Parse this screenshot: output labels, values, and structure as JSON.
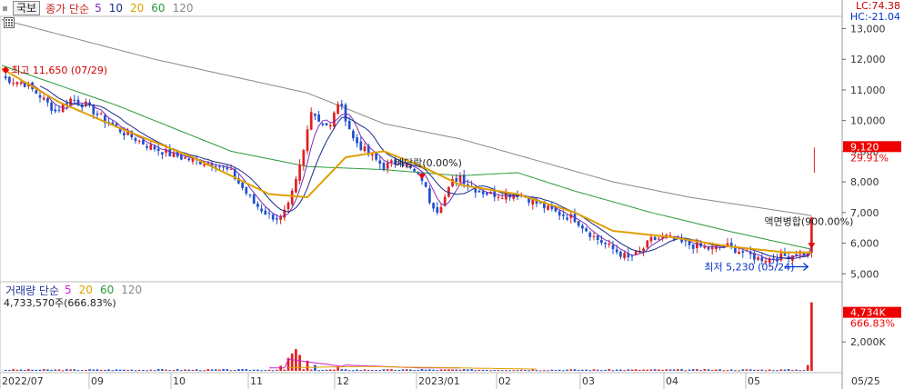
{
  "header": {
    "stock_button": "국보",
    "price_label": "종가 단순",
    "ma_periods": [
      "5",
      "10",
      "20",
      "60",
      "120"
    ],
    "ma_colors": [
      "#7a2fb8",
      "#1a2a8a",
      "#e0a000",
      "#2a9a3a",
      "#888888"
    ]
  },
  "volume_header": {
    "label": "거래량 단순",
    "ma_periods": [
      "5",
      "20",
      "60",
      "120"
    ],
    "value_text": "4,733,570주(666.83%)"
  },
  "readout": {
    "lc": "LC:74.38",
    "hc": "HC:-21.04"
  },
  "price_axis": {
    "ticks": [
      "13,000",
      "12,000",
      "11,000",
      "10,000",
      "9,000",
      "8,000",
      "7,000",
      "6,000",
      "5,000"
    ],
    "current_price": "9,120",
    "current_change": "29.91%"
  },
  "volume_axis": {
    "ticks": [
      "2,000K"
    ],
    "current_volume": "4,734K",
    "current_change": "666.83%"
  },
  "annotations": {
    "high": "최고 11,650 (07/29)",
    "low": "최저 5,230 (05/24)",
    "event1": "배당락(0.00%)",
    "event2": "액면병합(900.00%)"
  },
  "x_axis": {
    "labels": [
      "2022/07",
      "09",
      "10",
      "11",
      "12",
      "2023/01",
      "02",
      "03",
      "04",
      "05",
      "05/25"
    ]
  },
  "chart_data": {
    "type": "line",
    "y_range": [
      4800,
      13400
    ],
    "x_range": [
      0,
      220
    ],
    "close_series_anchors": [
      [
        0,
        11400
      ],
      [
        6,
        11200
      ],
      [
        10,
        10800
      ],
      [
        14,
        10300
      ],
      [
        18,
        10700
      ],
      [
        22,
        10500
      ],
      [
        27,
        10000
      ],
      [
        32,
        9600
      ],
      [
        38,
        9200
      ],
      [
        44,
        8900
      ],
      [
        50,
        8700
      ],
      [
        56,
        8600
      ],
      [
        60,
        8300
      ],
      [
        63,
        7800
      ],
      [
        66,
        7300
      ],
      [
        70,
        6900
      ],
      [
        73,
        6800
      ],
      [
        75,
        7200
      ],
      [
        77,
        8000
      ],
      [
        79,
        9000
      ],
      [
        81,
        10400
      ],
      [
        83,
        10000
      ],
      [
        86,
        9800
      ],
      [
        88,
        10600
      ],
      [
        90,
        10100
      ],
      [
        92,
        9400
      ],
      [
        96,
        8900
      ],
      [
        100,
        8500
      ],
      [
        104,
        8700
      ],
      [
        107,
        8400
      ],
      [
        110,
        8100
      ],
      [
        112,
        7400
      ],
      [
        114,
        7100
      ],
      [
        116,
        7500
      ],
      [
        118,
        8000
      ],
      [
        120,
        8200
      ],
      [
        122,
        7900
      ],
      [
        125,
        7700
      ],
      [
        128,
        7600
      ],
      [
        132,
        7600
      ],
      [
        136,
        7600
      ],
      [
        140,
        7300
      ],
      [
        145,
        7000
      ],
      [
        150,
        6800
      ],
      [
        155,
        6200
      ],
      [
        160,
        5800
      ],
      [
        164,
        5500
      ],
      [
        167,
        5700
      ],
      [
        170,
        6100
      ],
      [
        174,
        6200
      ],
      [
        178,
        6000
      ],
      [
        182,
        5900
      ],
      [
        186,
        5800
      ],
      [
        190,
        5900
      ],
      [
        194,
        5700
      ],
      [
        198,
        5500
      ],
      [
        202,
        5500
      ],
      [
        206,
        5600
      ],
      [
        209,
        5700
      ],
      [
        211,
        5600
      ],
      [
        212,
        6900
      ]
    ],
    "ma20_anchors": [
      [
        0,
        11700
      ],
      [
        15,
        10600
      ],
      [
        30,
        9800
      ],
      [
        50,
        8800
      ],
      [
        70,
        7600
      ],
      [
        80,
        7500
      ],
      [
        90,
        8800
      ],
      [
        100,
        9000
      ],
      [
        110,
        8500
      ],
      [
        120,
        7900
      ],
      [
        135,
        7600
      ],
      [
        150,
        7000
      ],
      [
        160,
        6400
      ],
      [
        175,
        6200
      ],
      [
        190,
        5900
      ],
      [
        205,
        5700
      ],
      [
        212,
        5700
      ]
    ],
    "ma60_anchors": [
      [
        0,
        11800
      ],
      [
        30,
        10500
      ],
      [
        60,
        9000
      ],
      [
        80,
        8500
      ],
      [
        100,
        8400
      ],
      [
        120,
        8200
      ],
      [
        135,
        8300
      ],
      [
        150,
        7700
      ],
      [
        170,
        7000
      ],
      [
        190,
        6400
      ],
      [
        212,
        5800
      ]
    ],
    "ma120_anchors": [
      [
        0,
        13300
      ],
      [
        40,
        12000
      ],
      [
        80,
        10900
      ],
      [
        100,
        9900
      ],
      [
        120,
        9400
      ],
      [
        140,
        8700
      ],
      [
        160,
        8000
      ],
      [
        180,
        7500
      ],
      [
        212,
        6900
      ]
    ],
    "volume_spikes": [
      [
        73,
        350
      ],
      [
        75,
        900
      ],
      [
        76,
        1200
      ],
      [
        77,
        1500
      ],
      [
        78,
        1100
      ],
      [
        80,
        700
      ],
      [
        82,
        400
      ],
      [
        88,
        300
      ],
      [
        110,
        120
      ],
      [
        211,
        400
      ],
      [
        212,
        4734
      ]
    ],
    "volume_range": [
      0,
      4900
    ]
  }
}
